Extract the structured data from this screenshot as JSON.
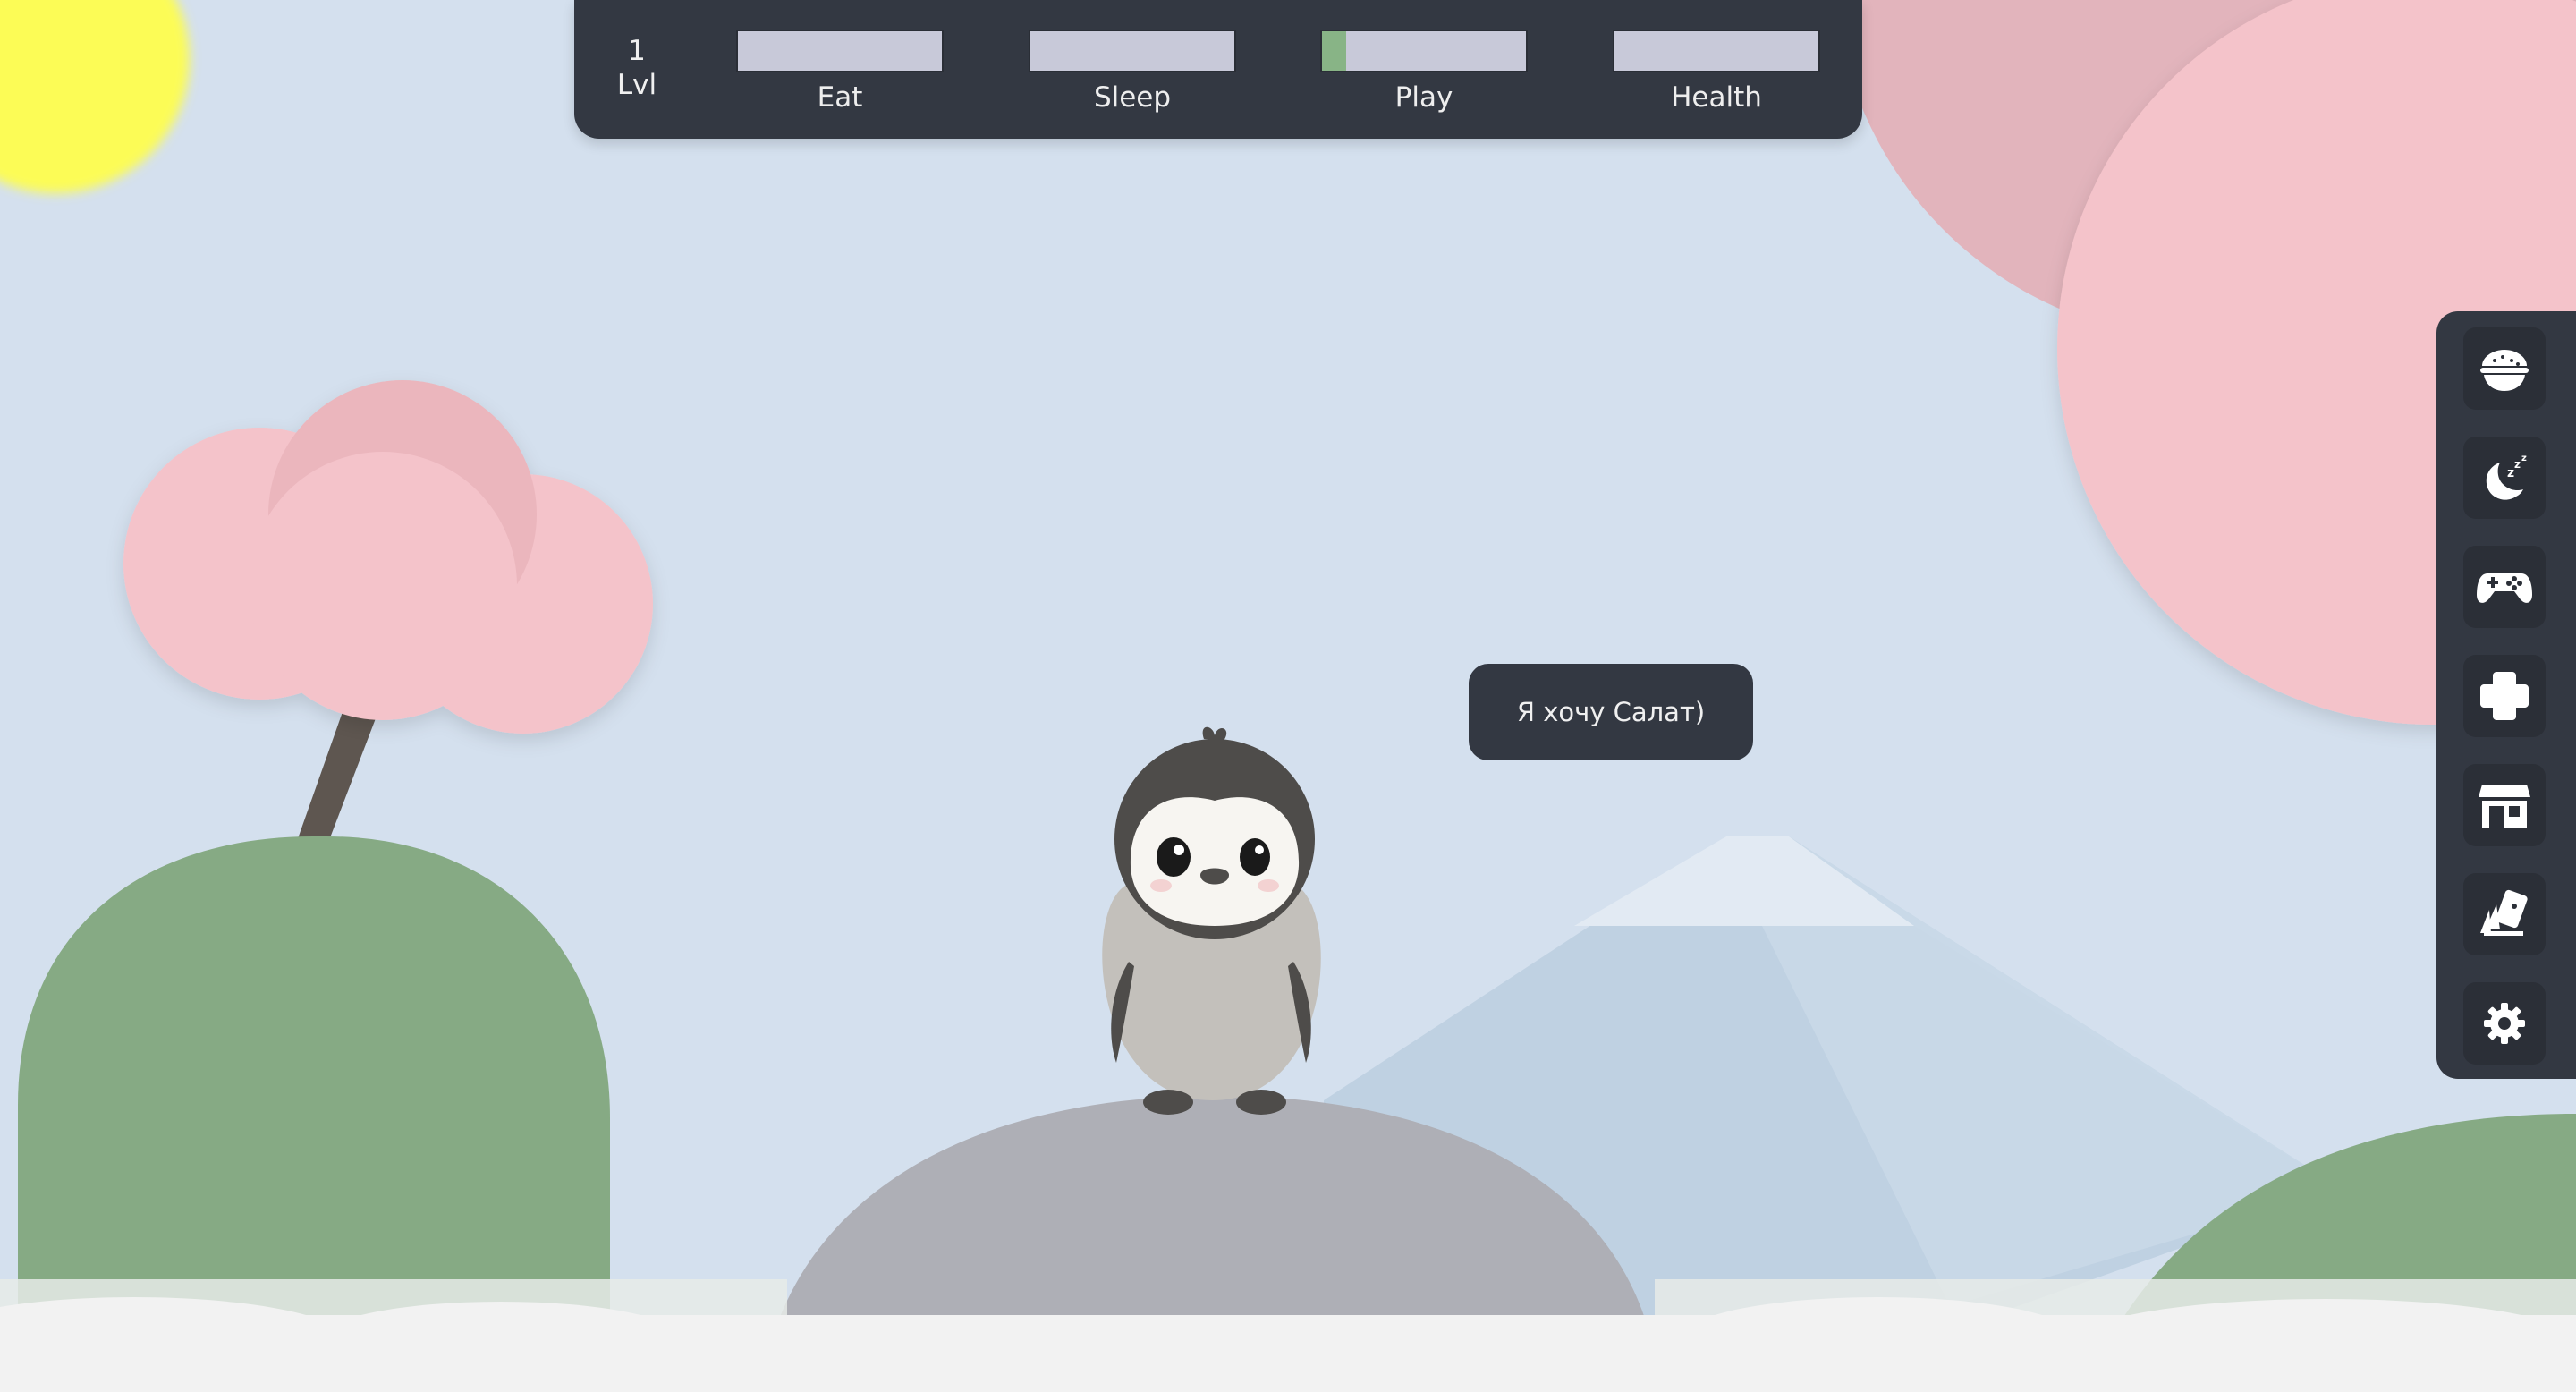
{
  "status": {
    "level_value": "1",
    "level_label": "Lvl",
    "stats": [
      {
        "label": "Eat",
        "value": 0
      },
      {
        "label": "Sleep",
        "value": 0
      },
      {
        "label": "Play",
        "value": 0.12
      },
      {
        "label": "Health",
        "value": 0
      }
    ]
  },
  "speech": "Я хочу Салат)",
  "actions": [
    {
      "name": "food-bowl-icon"
    },
    {
      "name": "sleep-moon-icon"
    },
    {
      "name": "gamepad-icon"
    },
    {
      "name": "health-cross-icon"
    },
    {
      "name": "shop-icon"
    },
    {
      "name": "cards-icon"
    },
    {
      "name": "settings-gear-icon"
    }
  ],
  "colors": {
    "sky": "#d4e0ee",
    "panel": "#333842",
    "bar_empty": "#c8c9d9",
    "bar_fill": "#88b486",
    "hill_green": "#86aa84",
    "blossom_pink": "#f4c3ca",
    "sun": "#fcfc56",
    "rock": "#aeafb6"
  }
}
